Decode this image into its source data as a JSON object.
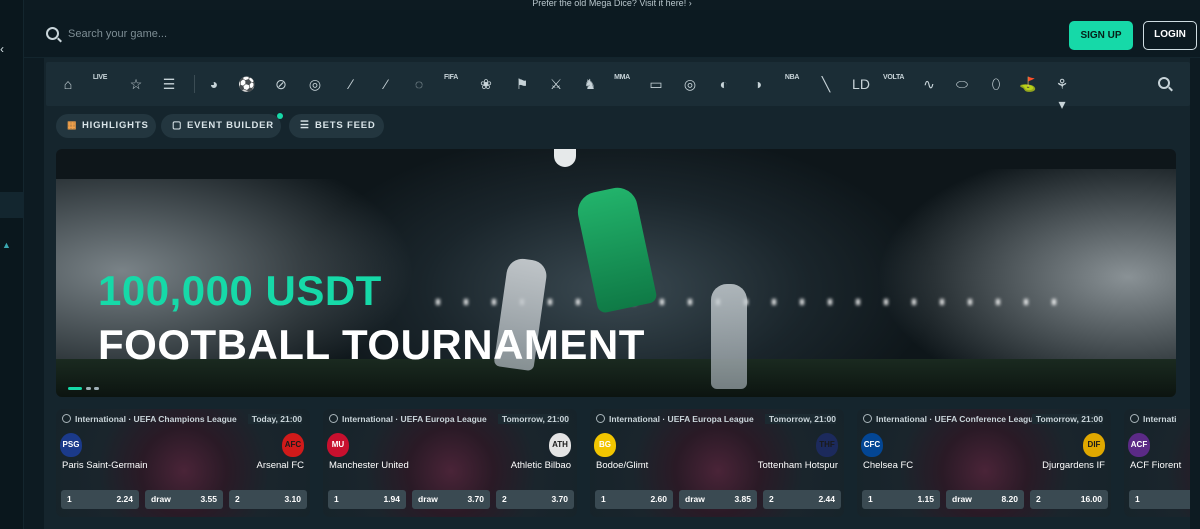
{
  "promo": "Prefer the old Mega Dice? Visit it here! ›",
  "header": {
    "search_placeholder": "Search your game...",
    "signup": "SIGN UP",
    "login": "LOGIN"
  },
  "sports_bar": {
    "items": [
      {
        "name": "home-icon",
        "glyph": "⌂"
      },
      {
        "name": "live-icon",
        "glyph": "LIVE"
      },
      {
        "name": "star-icon",
        "glyph": "☆"
      },
      {
        "name": "betslip-icon",
        "glyph": "☰"
      },
      {
        "name": "world-icon",
        "glyph": "◕"
      },
      {
        "name": "soccer-icon",
        "glyph": "⚽"
      },
      {
        "name": "tennis-icon",
        "glyph": "⊘"
      },
      {
        "name": "basketball-icon",
        "glyph": "◎"
      },
      {
        "name": "cricket-icon",
        "glyph": "∕"
      },
      {
        "name": "hockey-icon",
        "glyph": "⁄"
      },
      {
        "name": "table-tennis-icon",
        "glyph": "◌"
      },
      {
        "name": "fifa-icon",
        "glyph": "FIFA"
      },
      {
        "name": "badminton-icon",
        "glyph": "❀"
      },
      {
        "name": "racing-flag-icon",
        "glyph": "⚑"
      },
      {
        "name": "cs-icon",
        "glyph": "⚔"
      },
      {
        "name": "horse-racing-icon",
        "glyph": "♞"
      },
      {
        "name": "mma-icon",
        "glyph": "MMA"
      },
      {
        "name": "ticket-icon",
        "glyph": "▭"
      },
      {
        "name": "darts-icon",
        "glyph": "◎"
      },
      {
        "name": "volleyball-icon",
        "glyph": "◐"
      },
      {
        "name": "handball-icon",
        "glyph": "◑"
      },
      {
        "name": "nba2k-icon",
        "glyph": "NBA"
      },
      {
        "name": "esports-icon",
        "glyph": "╲"
      },
      {
        "name": "league-icon",
        "glyph": "LD"
      },
      {
        "name": "volta-icon",
        "glyph": "VOLTA"
      },
      {
        "name": "swimming-icon",
        "glyph": "∿"
      },
      {
        "name": "rugby-icon",
        "glyph": "⬭"
      },
      {
        "name": "american-football-icon",
        "glyph": "⬯"
      },
      {
        "name": "golf-icon",
        "glyph": "⛳"
      },
      {
        "name": "more-sports-icon",
        "glyph": "⚘ ▾"
      }
    ]
  },
  "tabs": [
    {
      "label": "HIGHLIGHTS",
      "icon": "▦"
    },
    {
      "label": "EVENT BUILDER",
      "icon": "▢"
    },
    {
      "label": "BETS FEED",
      "icon": "☰"
    }
  ],
  "banner": {
    "line1": "100,000 USDT",
    "line2": "FOOTBALL TOURNAMENT"
  },
  "colors": {
    "accent": "#16d9a8",
    "background": "#0d1b22"
  },
  "matches": [
    {
      "league": "International · UEFA Champions League",
      "time": "Today, 21:00",
      "home": "Paris Saint-Germain",
      "home_crest": "PSG",
      "home_color": "#1b3a8a",
      "away": "Arsenal FC",
      "away_crest": "AFC",
      "away_color": "#d11a1a",
      "odds": [
        {
          "label": "1",
          "value": "2.24"
        },
        {
          "label": "draw",
          "value": "3.55"
        },
        {
          "label": "2",
          "value": "3.10"
        }
      ]
    },
    {
      "league": "International · UEFA Europa League",
      "time": "Tomorrow, 21:00",
      "home": "Manchester United",
      "home_crest": "MU",
      "home_color": "#c8102e",
      "away": "Athletic Bilbao",
      "away_crest": "ATH",
      "away_color": "#e4e4e4",
      "odds": [
        {
          "label": "1",
          "value": "1.94"
        },
        {
          "label": "draw",
          "value": "3.70"
        },
        {
          "label": "2",
          "value": "3.70"
        }
      ]
    },
    {
      "league": "International · UEFA Europa League",
      "time": "Tomorrow, 21:00",
      "home": "Bodoe/Glimt",
      "home_crest": "BG",
      "home_color": "#f2c500",
      "away": "Tottenham Hotspur",
      "away_crest": "THF",
      "away_color": "#1c2a5c",
      "odds": [
        {
          "label": "1",
          "value": "2.60"
        },
        {
          "label": "draw",
          "value": "3.85"
        },
        {
          "label": "2",
          "value": "2.44"
        }
      ]
    },
    {
      "league": "International · UEFA Conference League",
      "time": "Tomorrow, 21:00",
      "home": "Chelsea FC",
      "home_crest": "CFC",
      "home_color": "#034694",
      "away": "Djurgardens IF",
      "away_crest": "DIF",
      "away_color": "#e0a800",
      "odds": [
        {
          "label": "1",
          "value": "1.15"
        },
        {
          "label": "draw",
          "value": "8.20"
        },
        {
          "label": "2",
          "value": "16.00"
        }
      ]
    },
    {
      "league": "Internati",
      "time": "",
      "home": "ACF Fiorent",
      "home_crest": "ACF",
      "home_color": "#5b2a86",
      "away": "",
      "away_crest": "",
      "away_color": "",
      "odds": [
        {
          "label": "1",
          "value": ""
        }
      ]
    }
  ]
}
